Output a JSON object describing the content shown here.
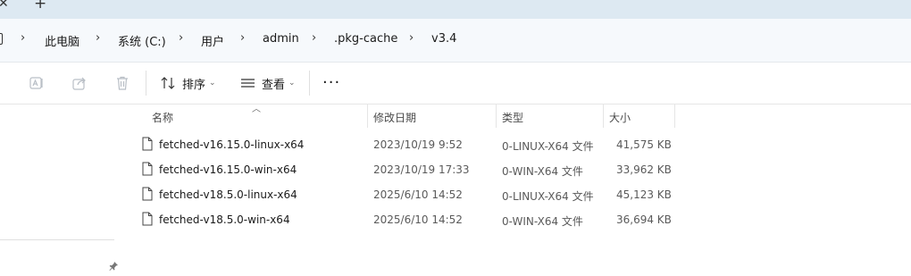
{
  "tabs": {
    "close_glyph": "✕",
    "new_tab_glyph": "+"
  },
  "breadcrumb": [
    "此电脑",
    "系统 (C:)",
    "用户",
    "admin",
    ".pkg-cache",
    "v3.4"
  ],
  "toolbar": {
    "icons": [
      "rename-icon",
      "share-icon",
      "delete-icon"
    ],
    "sort_label": "排序",
    "view_label": "查看",
    "more_glyph": "···"
  },
  "columns": {
    "name": "名称",
    "date": "修改日期",
    "type": "类型",
    "size": "大小"
  },
  "files": [
    {
      "name": "fetched-v16.15.0-linux-x64",
      "date": "2023/10/19 9:52",
      "type": "0-LINUX-X64 文件",
      "size": "41,575 KB"
    },
    {
      "name": "fetched-v16.15.0-win-x64",
      "date": "2023/10/19 17:33",
      "type": "0-WIN-X64 文件",
      "size": "33,962 KB"
    },
    {
      "name": "fetched-v18.5.0-linux-x64",
      "date": "2025/6/10 14:52",
      "type": "0-LINUX-X64 文件",
      "size": "45,123 KB"
    },
    {
      "name": "fetched-v18.5.0-win-x64",
      "date": "2025/6/10 14:52",
      "type": "0-WIN-X64 文件",
      "size": "36,694 KB"
    }
  ],
  "colors": {
    "tabstrip": "#dde9f2",
    "addressbar": "#f6f9fc",
    "disabled_icon": "#b9bfc6"
  }
}
